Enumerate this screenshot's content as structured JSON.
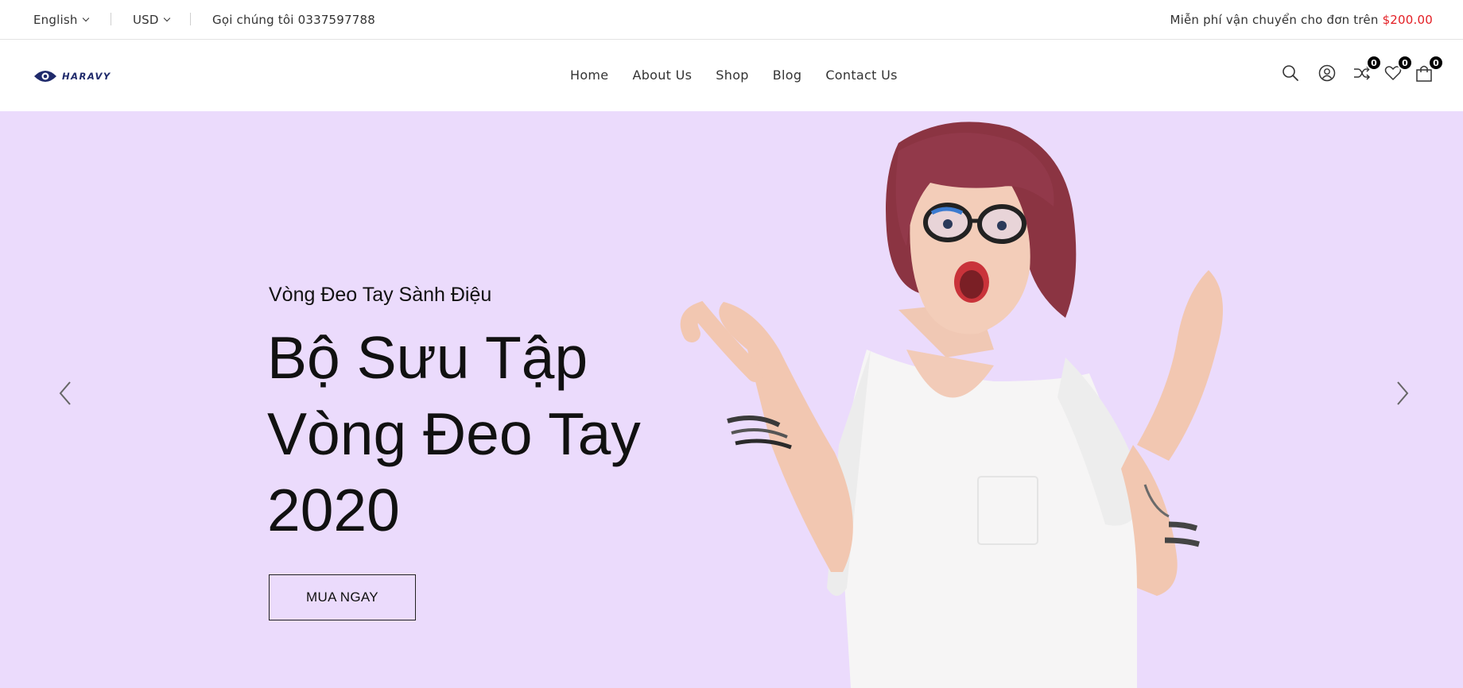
{
  "topbar": {
    "language": "English",
    "currency": "USD",
    "phone_text": "Gọi chúng tôi 0337597788",
    "shipping_text": "Miễn phí vận chuyển cho đơn trên",
    "shipping_price": "$200.00",
    "price_color": "#e31e24"
  },
  "header": {
    "logo_text": "HARAVY",
    "nav": [
      "Home",
      "About Us",
      "Shop",
      "Blog",
      "Contact Us"
    ],
    "icons": {
      "compare_count": "0",
      "wishlist_count": "0",
      "cart_count": "0"
    }
  },
  "hero": {
    "subtitle": "Vòng Đeo Tay Sành Điệu",
    "title_lines": [
      "Bộ Sưu Tập",
      "Vòng Đeo Tay",
      "2020"
    ],
    "button_label": "MUA NGAY",
    "background_color": "#ebdbfc"
  }
}
